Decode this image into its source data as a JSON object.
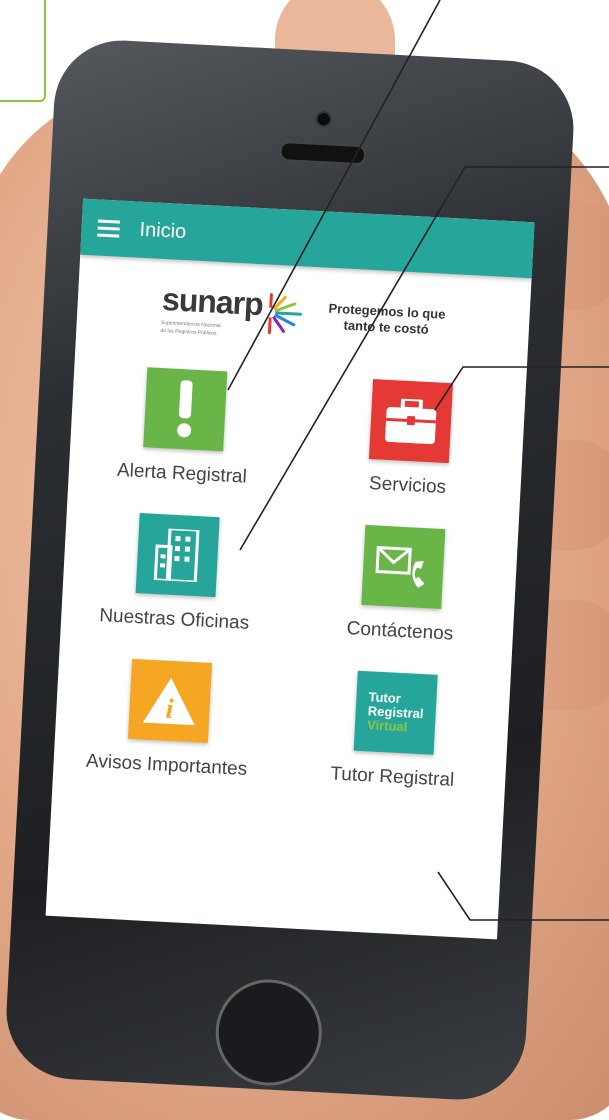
{
  "appbar": {
    "title": "Inicio"
  },
  "brand": {
    "logo_text": "sunarp",
    "logo_sub_line1": "Superintendencia Nacional",
    "logo_sub_line2": "de los Registros Públicos",
    "tagline_line1": "Protegemos lo que",
    "tagline_line2": "tanto te costó"
  },
  "menu": [
    {
      "label": "Alerta Registral",
      "icon": "alert-icon",
      "color": "#6ab547"
    },
    {
      "label": "Servicios",
      "icon": "briefcase-icon",
      "color": "#e53935"
    },
    {
      "label": "Nuestras Oficinas",
      "icon": "building-icon",
      "color": "#26a69a"
    },
    {
      "label": "Contáctenos",
      "icon": "contact-icon",
      "color": "#6ab547"
    },
    {
      "label": "Avisos Importantes",
      "icon": "info-icon",
      "color": "#f5a623"
    },
    {
      "label": "Tutor Registral",
      "icon": "tutor-icon",
      "color": "#26a69a",
      "icon_text": [
        "Tutor",
        "Registral",
        "Virtual"
      ]
    }
  ],
  "colors": {
    "appbar": "#26a69a",
    "callout": "#8cc63f"
  }
}
